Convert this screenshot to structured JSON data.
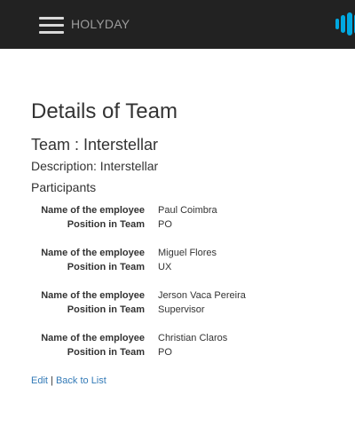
{
  "navbar": {
    "menu_icon": "hamburger-menu-icon",
    "brand": "HOLYDAY",
    "logo_icon": "brand-logo-icon",
    "colors": {
      "background": "#222222",
      "brand_text": "#9d9d9d",
      "logo": "#00a8e0"
    }
  },
  "page": {
    "title": "Details of Team",
    "team_heading": "Team : Interstellar",
    "description": "Description: Interstellar",
    "participants_label": "Participants"
  },
  "participant_labels": {
    "name": "Name of the employee",
    "position": "Position in Team"
  },
  "participants": [
    {
      "name": "Paul Coimbra",
      "position": "PO"
    },
    {
      "name": "Miguel Flores",
      "position": "UX"
    },
    {
      "name": "Jerson Vaca Pereira",
      "position": "Supervisor"
    },
    {
      "name": "Christian Claros",
      "position": "PO"
    }
  ],
  "links": {
    "edit": "Edit",
    "separator": " | ",
    "back": "Back to List",
    "link_color": "#337ab7"
  }
}
